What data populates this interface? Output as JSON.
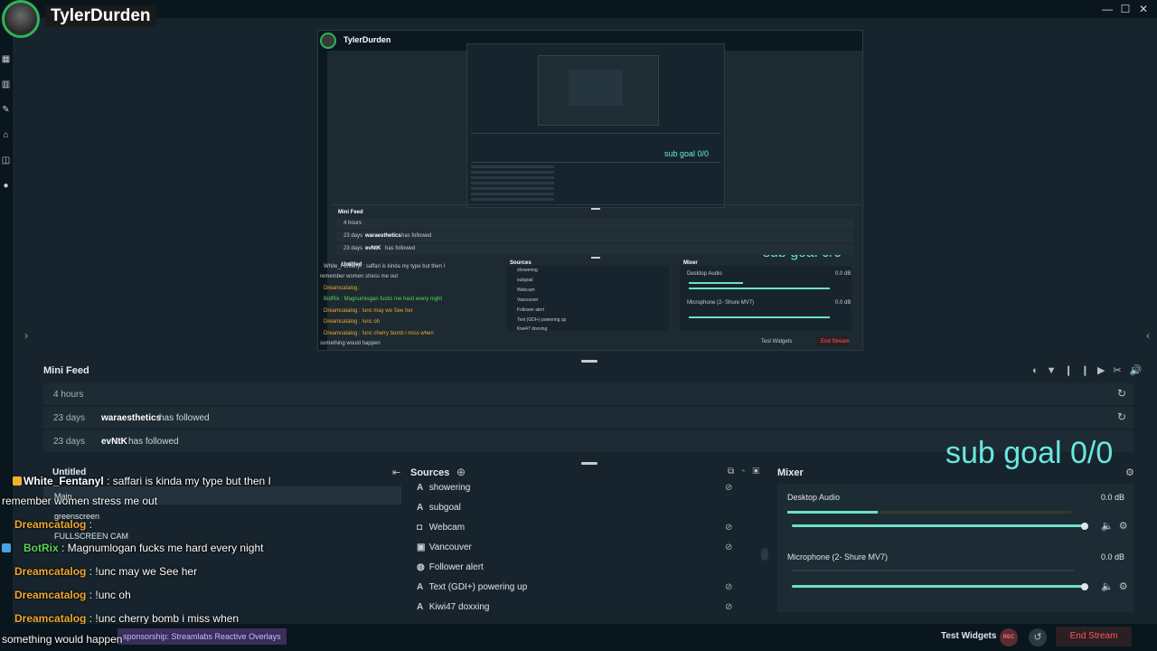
{
  "window": {
    "minimize": "—",
    "maximize": "☐",
    "close": "✕"
  },
  "streamer_name": "TylerDurden",
  "preview": {
    "inner_name": "TylerDurden",
    "inner_goal": "sub goal 0/0",
    "inner_mini_feed": "Mini Feed",
    "inner_hours": "4 hours",
    "inner_follow1_days": "23 days",
    "inner_follow1_name": "waraesthetics",
    "inner_follow1_text": "has followed",
    "inner_follow2_days": "23 days",
    "inner_follow2_name": "evNtK",
    "inner_follow2_text": "has followed",
    "inner_sources": "Sources",
    "inner_mixer": "Mixer",
    "inner_desktop_audio": "Desktop Audio",
    "inner_mic": "Microphone (2- Shure MV7)",
    "inner_db1": "0.0 dB",
    "inner_db2": "0.0 dB",
    "inner_test_widgets": "Test Widgets",
    "inner_end_stream": "End Stream",
    "inner_sources_list": [
      "showering",
      "subgoal",
      "Webcam",
      "Vancouver",
      "Follower alert",
      "Text (GDI+) powering up",
      "Kiwi47 doxxing"
    ],
    "inner_scene": "Untitled",
    "inner_chat": [
      "White_Fentanyl : saffari is kinda my type but then I",
      "remember women stress me out",
      "Dreamcatalog :",
      "BotRix : Magnumlogan fucks me hard every night",
      "Dreamcatalog : !unc may we See her",
      "Dreamcatalog : !unc oh",
      "Dreamcatalog : !unc cherry bomb i miss when",
      "something would happen"
    ]
  },
  "mini_feed": {
    "title": "Mini Feed",
    "group_label": "4 hours",
    "items": [
      {
        "days": "23 days",
        "name": "waraesthetics",
        "action": "has followed"
      },
      {
        "days": "23 days",
        "name": "evNtK",
        "action": "has followed"
      }
    ]
  },
  "goal_overlay": "sub goal 0/0",
  "scenes": {
    "title": "Untitled",
    "items": [
      "Main",
      "greenscreen",
      "FULLSCREEN CAM"
    ]
  },
  "sources": {
    "title": "Sources",
    "items": [
      {
        "label": "showering",
        "icon": "A"
      },
      {
        "label": "subgoal",
        "icon": "A"
      },
      {
        "label": "Webcam",
        "icon": "◘"
      },
      {
        "label": "Vancouver",
        "icon": "▣"
      },
      {
        "label": "Follower alert",
        "icon": "◍"
      },
      {
        "label": "Text (GDI+) powering up",
        "icon": "A"
      },
      {
        "label": "Kiwi47 doxxing",
        "icon": "A"
      }
    ]
  },
  "mixer": {
    "title": "Mixer",
    "channels": [
      {
        "name": "Desktop Audio",
        "db": "0.0 dB"
      },
      {
        "name": "Microphone (2- Shure MV7)",
        "db": "0.0 dB"
      }
    ]
  },
  "chat": [
    {
      "user": "White_Fentanyl",
      "msg": " : saffari is kinda my type but then I",
      "color": "#ffffff"
    },
    {
      "user": "",
      "msg": "remember women stress me out",
      "color": "#ffffff"
    },
    {
      "user": "Dreamcatalog",
      "msg": " :",
      "color": "#f0a830"
    },
    {
      "user": "BotRix",
      "msg": " : Magnumlogan fucks me hard every night",
      "color": "#5ad65a"
    },
    {
      "user": "Dreamcatalog",
      "msg": " : !unc may we See her",
      "color": "#f0a830"
    },
    {
      "user": "Dreamcatalog",
      "msg": " : !unc oh",
      "color": "#f0a830"
    },
    {
      "user": "Dreamcatalog",
      "msg": " : !unc cherry bomb i miss when",
      "color": "#f0a830"
    },
    {
      "user": "",
      "msg": "something would happen",
      "color": "#ffffff"
    }
  ],
  "sponsorship": "sponsorship: Streamlabs Reactive Overlays",
  "footer": {
    "test_widgets": "Test Widgets",
    "end_stream": "End Stream",
    "rec": "REC"
  }
}
